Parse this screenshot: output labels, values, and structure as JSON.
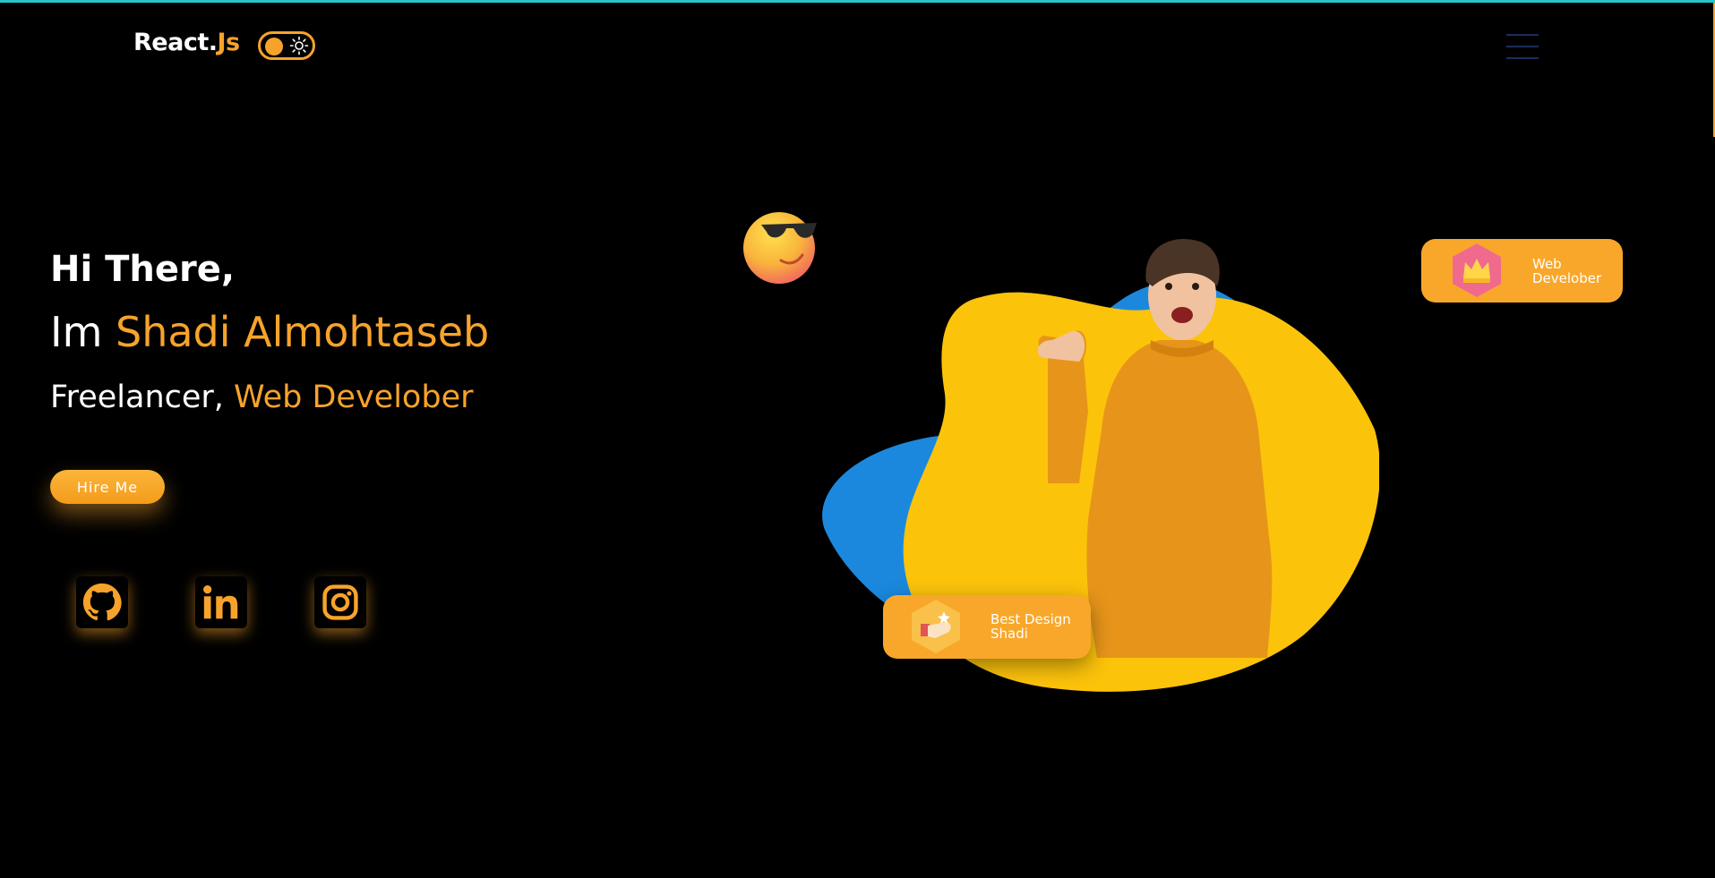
{
  "header": {
    "logo_main": "React.",
    "logo_accent": "Js",
    "theme_toggle": "dark-mode-toggle",
    "menu_icon": "hamburger-menu-icon"
  },
  "hero": {
    "greeting": "Hi There,",
    "name_prefix": "Im ",
    "name": "Shadi Almohtaseb",
    "role_prefix": "Freelancer, ",
    "role": "Web Develober",
    "hire_label": "Hire Me"
  },
  "socials": [
    {
      "name": "github-icon"
    },
    {
      "name": "linkedin-icon"
    },
    {
      "name": "instagram-icon"
    }
  ],
  "badges": {
    "web_line1": "Web",
    "web_line2": "Develober",
    "design_line1": "Best Design",
    "design_line2": "Shadi"
  },
  "colors": {
    "accent": "#f7a32b",
    "background": "#000000",
    "blob_yellow": "#fcc30b",
    "blob_blue": "#1b88de",
    "top_border": "#27c5c5"
  }
}
